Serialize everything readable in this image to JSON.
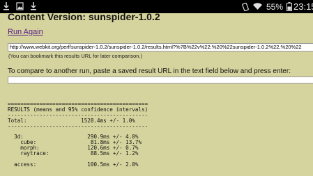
{
  "status_bar": {
    "battery_percent": "55%",
    "time": "23:15",
    "left_icons": [
      "download-icon",
      "image-icon",
      "download-icon"
    ],
    "right_icons": [
      "vibrate-icon",
      "wifi-icon",
      "battery-icon"
    ]
  },
  "page": {
    "title": "Content Version: sunspider-1.0.2",
    "run_again": "Run Again",
    "url_value": "http://www.webkit.org/perf/sunspider-1.0.2/sunspider-1.0.2/results.html?%7B%22v%22:%20%22sunspider-1.0.2%22,%20%22",
    "bookmark_note": "(You can bookmark this results URL for later comparison.)",
    "compare_prompt": "To compare to another run, paste a saved result URL in the text field below and press enter:",
    "compare_value": ""
  },
  "results": {
    "separator": "============================================",
    "header": "RESULTS (means and 95% confidence intervals)",
    "divider": "--------------------------------------------",
    "total_line": "Total:                 1528.4ms +/- 1.0%",
    "divider2": "--------------------------------------------",
    "rows": [
      "",
      "  3d:                    290.9ms +/- 4.0%",
      "    cube:                 81.8ms +/- 13.7%",
      "    morph:               120.6ms +/- 0.7%",
      "    raytrace:             88.5ms +/- 1.2%",
      "",
      "  access:                100.5ms +/- 2.0%"
    ]
  }
}
